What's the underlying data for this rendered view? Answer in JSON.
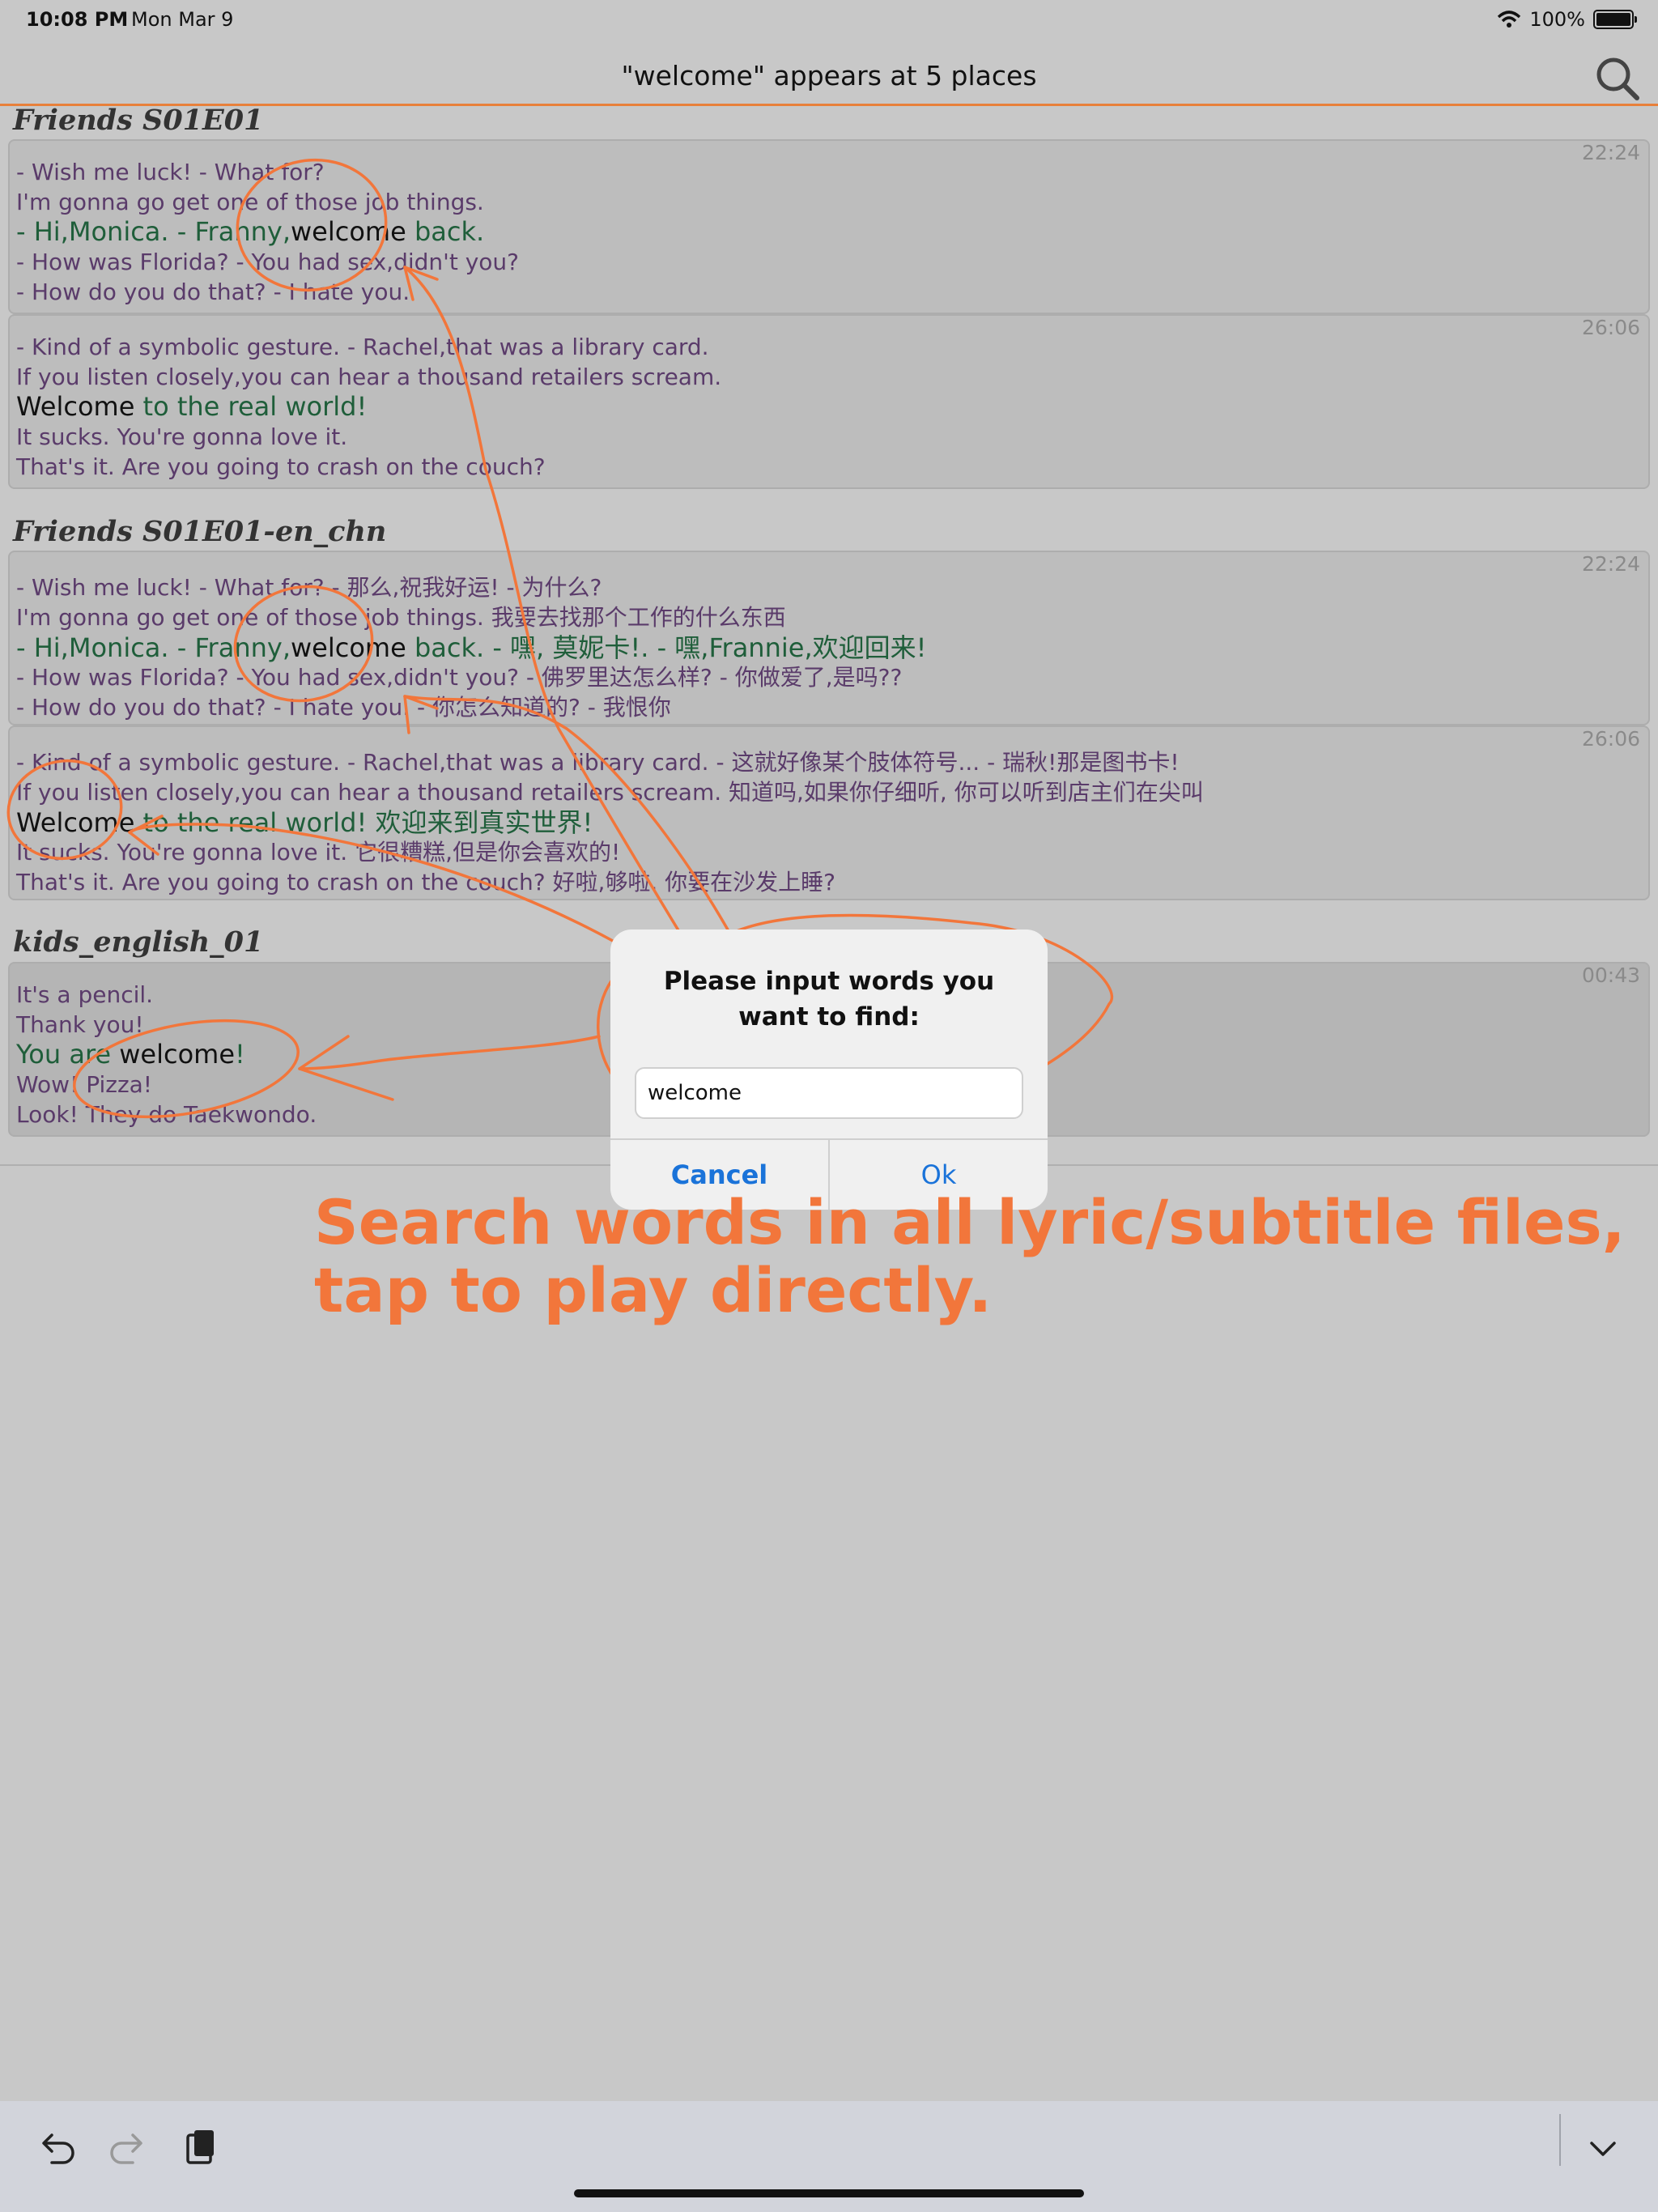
{
  "status_bar": {
    "time": "10:08 PM",
    "date": "Mon Mar 9",
    "battery_percent": "100%",
    "wifi_icon": "wifi-icon",
    "battery_icon": "battery-icon"
  },
  "nav": {
    "title": "\"welcome\" appears at 5 places",
    "search_icon": "search-icon",
    "accent_color": "#e8803a"
  },
  "results": [
    {
      "file": "Friends S01E01",
      "entries": [
        {
          "time": "22:24",
          "lines": [
            {
              "pre": "- Wish me luck! - What for?",
              "word": "",
              "post": ""
            },
            {
              "pre": "I'm gonna go get one of those job things.",
              "word": "",
              "post": ""
            },
            {
              "pre": "- Hi,Monica. - Franny,",
              "word": "welcome",
              "post": " back."
            },
            {
              "pre": "- How was Florida? - You had sex,didn't you?",
              "word": "",
              "post": ""
            },
            {
              "pre": "- How do you do that? - I hate you.",
              "word": "",
              "post": ""
            }
          ]
        },
        {
          "time": "26:06",
          "lines": [
            {
              "pre": "- Kind of a symbolic gesture. - Rachel,that was a library card.",
              "word": "",
              "post": ""
            },
            {
              "pre": "If you listen closely,you can hear a thousand retailers scream.",
              "word": "",
              "post": ""
            },
            {
              "pre": "",
              "word": "Welcome",
              "post": " to the real world!"
            },
            {
              "pre": "It sucks. You're gonna love it.",
              "word": "",
              "post": ""
            },
            {
              "pre": "That's it. Are you going to crash on the couch?",
              "word": "",
              "post": ""
            }
          ]
        }
      ]
    },
    {
      "file": "Friends S01E01-en_chn",
      "entries": [
        {
          "time": "22:24",
          "lines": [
            {
              "pre": "- Wish me luck! - What for? - 那么,祝我好运! - 为什么?",
              "word": "",
              "post": ""
            },
            {
              "pre": "I'm gonna go get one of those job things. 我要去找那个工作的什么东西",
              "word": "",
              "post": ""
            },
            {
              "pre": "- Hi,Monica. - Franny,",
              "word": "welcome",
              "post": " back. - 嘿, 莫妮卡!. - 嘿,Frannie,欢迎回来!"
            },
            {
              "pre": "- How was Florida? - You had sex,didn't you? - 佛罗里达怎么样? - 你做爱了,是吗??",
              "word": "",
              "post": ""
            },
            {
              "pre": "- How do you do that? - I hate you. - 你怎么知道的? - 我恨你",
              "word": "",
              "post": ""
            }
          ]
        },
        {
          "time": "26:06",
          "lines": [
            {
              "pre": "- Kind of a symbolic gesture. - Rachel,that was a library card. - 这就好像某个肢体符号... - 瑞秋!那是图书卡!",
              "word": "",
              "post": ""
            },
            {
              "pre": "If you listen closely,you can hear a thousand retailers scream. 知道吗,如果你仔细听, 你可以听到店主们在尖叫",
              "word": "",
              "post": ""
            },
            {
              "pre": "",
              "word": "Welcome",
              "post": " to the real world! 欢迎来到真实世界!"
            },
            {
              "pre": "It sucks. You're gonna love it. 它很糟糕,但是你会喜欢的!",
              "word": "",
              "post": ""
            },
            {
              "pre": "That's it. Are you going to crash on the couch? 好啦,够啦. 你要在沙发上睡?",
              "word": "",
              "post": ""
            }
          ]
        }
      ]
    },
    {
      "file": "kids_english_01",
      "entries": [
        {
          "time": "00:43",
          "lines": [
            {
              "pre": "It's a pencil.",
              "word": "",
              "post": ""
            },
            {
              "pre": "Thank you!",
              "word": "",
              "post": ""
            },
            {
              "pre": "You are ",
              "word": "welcome",
              "post": "!"
            },
            {
              "pre": "Wow! Pizza!",
              "word": "",
              "post": ""
            },
            {
              "pre": "Look! They do Taekwondo.",
              "word": "",
              "post": ""
            }
          ]
        }
      ]
    }
  ],
  "dialog": {
    "title": "Please input words you want to find:",
    "input_value": "welcome",
    "cancel_label": "Cancel",
    "ok_label": "Ok"
  },
  "annotation": {
    "caption_line1": "Search words in all lyric/subtitle files,",
    "caption_line2": "tap to play directly.",
    "color": "#f2763b"
  },
  "toolbar": {
    "undo_icon": "undo-icon",
    "redo_icon": "redo-icon",
    "paste_icon": "clipboard-icon",
    "collapse_icon": "chevron-down-icon"
  }
}
